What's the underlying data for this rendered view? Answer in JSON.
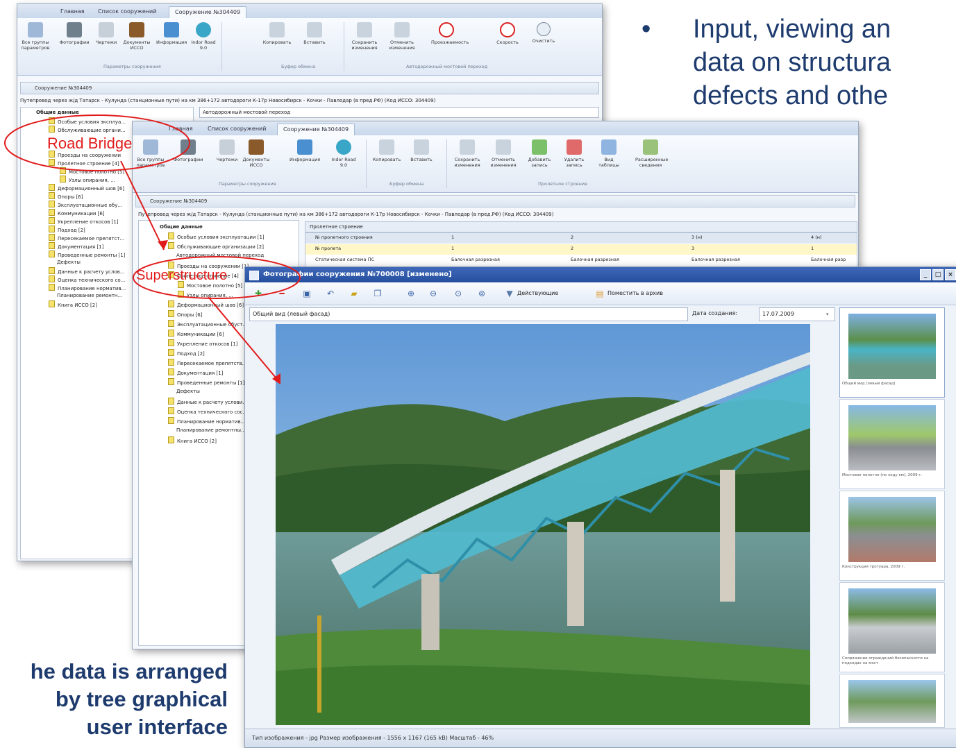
{
  "bullet": {
    "symbol": "•",
    "lines": [
      "Input, viewing an",
      "data on structura",
      "defects and othe"
    ]
  },
  "caption": {
    "lines": [
      "he data is arranged",
      "by tree graphical",
      "user interface"
    ]
  },
  "annotations": {
    "road_bridge": "Road Bridge",
    "superstructure": "Superstructure",
    "color": "#e11b1b"
  },
  "window_back": {
    "tabs": [
      "Главная",
      "Список сооружений",
      "Сооружение №304409"
    ],
    "buttons": [
      "Все группы параметров",
      "Фотографии",
      "Чертежи",
      "Документы ИССО",
      "Информация",
      "Indor Road 9.0",
      "Копировать",
      "Вставить",
      "Сохранить изменения",
      "Отменить изменения",
      "Проезжаемость",
      "Скорость",
      "Очистить"
    ],
    "groups": [
      "Параметры сооружения",
      "Буфер обмена",
      "Автодорожный мостовой переход"
    ],
    "doc_title": "Сооружение №304409",
    "path": "Путепровод через ж/д Татарск - Кулунда (станционные пути) на км 386+172 автодороги К-17р Новосибирск - Кочки - Павлодар (в пред.РФ) (Код ИССО: 304409)",
    "combo": "Автодорожный мостовой переход",
    "tree": [
      "Общие данные",
      "Особые условия эксплуа...",
      "Обслуживающие органи...",
      "Проезды на сооружении",
      "Пролетное строение [4]",
      "Мостовое полотно [5]",
      "Узлы опирания, ...",
      "Деформационный шов [6]",
      "Опоры [6]",
      "Эксплуатационные обу...",
      "Коммуникации [6]",
      "Укрепление откосов [1]",
      "Подход [2]",
      "Пересекаемое препятст...",
      "Документация [1]",
      "Проведенные ремонты [1]",
      "Дефекты",
      "Данные к расчету услов...",
      "Оценка технического со...",
      "Планирование норматив...",
      "Планирование ремонтн...",
      "Книга ИССО [2]"
    ]
  },
  "window_mid": {
    "tabs": [
      "Главная",
      "Список сооружений",
      "Сооружение №304409"
    ],
    "buttons": [
      "Все группы параметров",
      "Фотографии",
      "Чертежи",
      "Документы ИССО",
      "Информация",
      "Indor Road 9.0",
      "Копировать",
      "Вставить",
      "Сохранить изменения",
      "Отменить изменения",
      "Добавить запись",
      "Удалить запись",
      "Вид таблицы",
      "Расширенные сведения"
    ],
    "groups": [
      "Параметры сооружения",
      "Буфер обмена",
      "Пролетное строение"
    ],
    "doc_title": "Сооружение №304409",
    "path": "Путепровод через ж/д Татарск - Кулунда (станционные пути) на км 386+172 автодороги К-17р Новосибирск - Кочки - Павлодар (в пред.РФ) (Код ИССО: 304409)",
    "section": "Пролетное строение",
    "table": {
      "columns": [
        "№ пролетного строения",
        "1",
        "2",
        "3 (н)",
        "4 (н)"
      ],
      "rows": [
        [
          "№ пролета",
          "1",
          "2",
          "3",
          "1"
        ],
        [
          "Статическая система ПС",
          "Балочная разрезная",
          "Балочная разрезная",
          "Балочная разрезная",
          "Балочная разр"
        ]
      ]
    },
    "tree": [
      "Общие данные",
      "Особые условия эксплуатации [1]",
      "Обслуживающие организации [2]",
      "Автодорожный мостовой переход",
      "Проезды на сооружении [1]",
      "Пролетное строение [4]",
      "Мостовое полотно [5]",
      "Узлы опирания, ...",
      "Деформационный шов [6]",
      "Опоры [6]",
      "Эксплуатационные обуст...",
      "Коммуникации [6]",
      "Укрепление откосов [1]",
      "Подход [2]",
      "Пересекаемое препятств...",
      "Документация [1]",
      "Проведенные ремонты [1]",
      "Дефекты",
      "Данные к расчету услови...",
      "Оценка технического сос...",
      "Планирование норматив...",
      "Планирование ремонтны...",
      "Книга ИССО [2]"
    ]
  },
  "photo_window": {
    "title": "Фотографии сооружения №700008 [изменено]",
    "toolbar": {
      "active_label": "Действующие",
      "archive_label": "Поместить в архив"
    },
    "photo_name": "Общий вид (левый фасад)",
    "date_label": "Дата создания:",
    "date_value": "17.07.2009",
    "thumbs": [
      "Общий вид (левый фасад)",
      "Мостовое полотно (по ходу км), 2009 г.",
      "Конструкция тротуара, 2009 г.",
      "Сопряжение ограждений безопасности на подходах на мост",
      ""
    ],
    "status": "Тип изображения - jpg   Размер изображения - 1556 x 1167 (165 kB)   Масштаб - 46%"
  }
}
